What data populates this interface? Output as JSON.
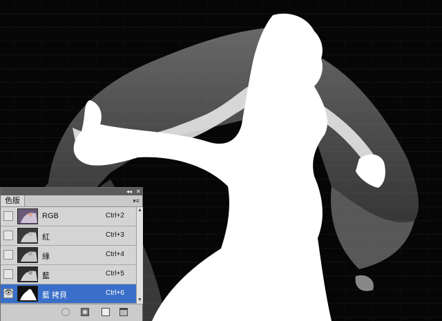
{
  "panel": {
    "tab_label": "色版",
    "collapse_glyph": "◂◂",
    "close_glyph": "✕",
    "menu_glyph": "▾≡",
    "channels": [
      {
        "name": "RGB",
        "shortcut": "Ctrl+2",
        "visible": false,
        "selected": false
      },
      {
        "name": "紅",
        "shortcut": "Ctrl+3",
        "visible": false,
        "selected": false
      },
      {
        "name": "綠",
        "shortcut": "Ctrl+4",
        "visible": false,
        "selected": false
      },
      {
        "name": "藍",
        "shortcut": "Ctrl+5",
        "visible": false,
        "selected": false
      },
      {
        "name": "藍 拷貝",
        "shortcut": "Ctrl+6",
        "visible": true,
        "selected": true
      }
    ],
    "eye_glyph": "👁",
    "scroll_up_glyph": "▲",
    "scroll_down_glyph": "▼",
    "bottom_icons": [
      "load-selection-icon",
      "save-selection-icon",
      "new-channel-icon",
      "delete-channel-icon"
    ]
  },
  "colors": {
    "selection": "#3a6fc9",
    "panel_bg": "#d4d4d4",
    "canvas_bg": "#050505"
  }
}
